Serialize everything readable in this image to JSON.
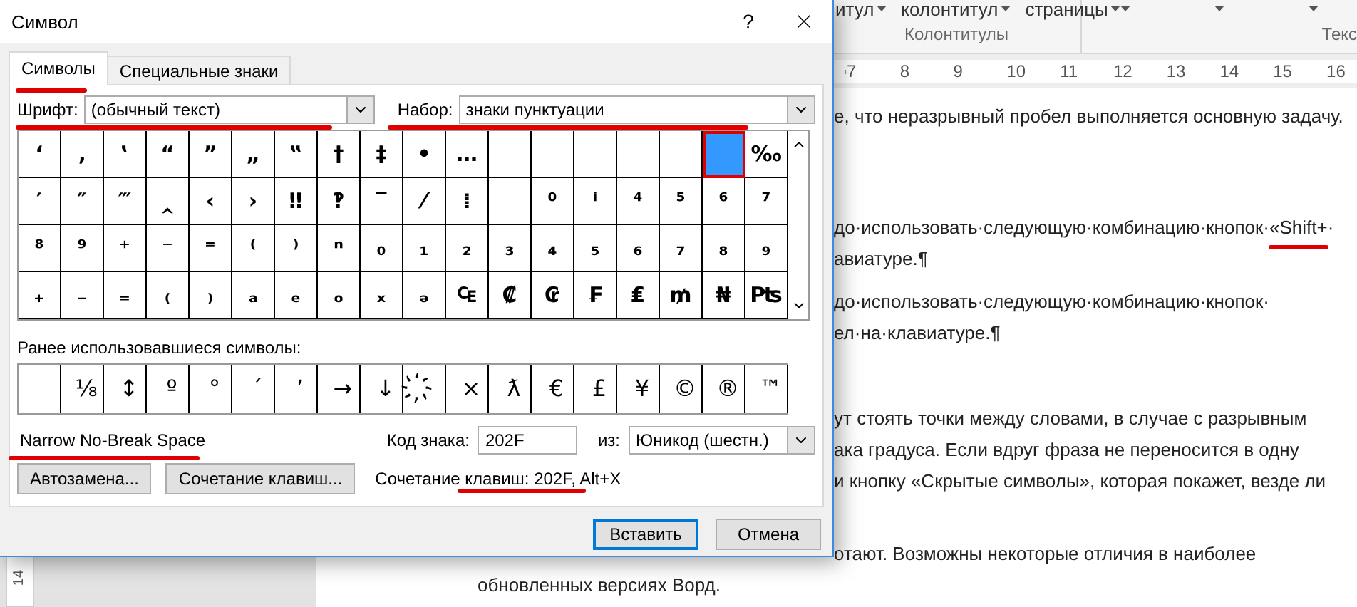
{
  "ribbon": {
    "groups": [
      {
        "label": "Колонтитулы",
        "buttons": [
          {
            "kind": "labeled",
            "label": "итул"
          },
          {
            "kind": "labeled",
            "label": "колонтитул"
          },
          {
            "kind": "labeled",
            "label": "страницы"
          }
        ]
      },
      {
        "label": "Текс",
        "buttons": [
          {
            "kind": "caret"
          },
          {
            "kind": "caret"
          },
          {
            "kind": "caret"
          }
        ]
      }
    ]
  },
  "ruler": {
    "numbers": [
      "7",
      "8",
      "9",
      "10",
      "11",
      "12",
      "13",
      "14",
      "15",
      "16"
    ]
  },
  "vertical_ruler": {
    "labels": [
      "14"
    ]
  },
  "document": {
    "paragraphs": [
      {
        "lines": [
          {
            "kind": "clipped",
            "text": "е, что неразрывный пробел выполняется основную задачу."
          }
        ]
      },
      {
        "lines": [
          {
            "kind": "clipped",
            "text": "до·использовать·следующую·комбинацию·кнопок·«Shift+·"
          },
          {
            "kind": "clipped",
            "text": "авиатуре.¶"
          }
        ]
      },
      {
        "lines": [
          {
            "kind": "clipped",
            "text": "до·использовать·следующую·комбинацию·кнопок·"
          },
          {
            "kind": "clipped",
            "text": "ел·на·клавиатуре.¶"
          }
        ]
      },
      {
        "lines": [
          {
            "kind": "clipped",
            "text": "ут стоять точки между словами, в случае с разрывным"
          },
          {
            "kind": "clipped",
            "text": "ака градуса. Если вдруг фраза не переносится в одну"
          },
          {
            "kind": "clipped",
            "text": "и кнопку «Скрытые символы», которая покажет, везде ли"
          }
        ]
      },
      {
        "lines": [
          {
            "kind": "clipped",
            "text": "отают. Возможны некоторые отличия в наиболее"
          },
          {
            "kind": "full",
            "text": "обновленных версиях Ворд."
          }
        ]
      }
    ]
  },
  "dialog": {
    "title": "Символ",
    "help": "?",
    "tabs": [
      {
        "label": "Символы",
        "selected": true
      },
      {
        "label": "Специальные знаки",
        "selected": false
      }
    ],
    "font": {
      "label": "Шрифт:",
      "value": "(обычный текст)"
    },
    "subset": {
      "label": "Набор:",
      "value": "знаки пунктуации"
    },
    "grid": {
      "rows": [
        {
          "cells": [
            {
              "kind": "glyph",
              "char": "‘",
              "selected": false
            },
            {
              "kind": "glyph",
              "char": "‚",
              "selected": false
            },
            {
              "kind": "glyph",
              "char": "‛",
              "selected": false
            },
            {
              "kind": "glyph",
              "char": "“",
              "selected": false
            },
            {
              "kind": "glyph",
              "char": "”",
              "selected": false
            },
            {
              "kind": "glyph",
              "char": "„",
              "selected": false
            },
            {
              "kind": "glyph",
              "char": "‟",
              "selected": false
            },
            {
              "kind": "glyph",
              "char": "†",
              "selected": false
            },
            {
              "kind": "glyph",
              "char": "‡",
              "selected": false
            },
            {
              "kind": "glyph",
              "char": "•",
              "selected": false
            },
            {
              "kind": "glyph",
              "char": "…",
              "selected": false
            },
            {
              "kind": "blank",
              "selected": false
            },
            {
              "kind": "blank",
              "selected": false
            },
            {
              "kind": "blank",
              "selected": false
            },
            {
              "kind": "blank",
              "selected": false
            },
            {
              "kind": "blank",
              "selected": false
            },
            {
              "kind": "blank",
              "selected": true
            },
            {
              "kind": "glyph",
              "char": "‰",
              "selected": false
            }
          ]
        },
        {
          "cells": [
            {
              "kind": "glyph",
              "char": "′",
              "selected": false
            },
            {
              "kind": "glyph",
              "char": "″",
              "selected": false
            },
            {
              "kind": "glyph",
              "char": "‴",
              "selected": false
            },
            {
              "kind": "glyph",
              "char": "‸",
              "selected": false
            },
            {
              "kind": "glyph",
              "char": "‹",
              "selected": false
            },
            {
              "kind": "glyph",
              "char": "›",
              "selected": false
            },
            {
              "kind": "glyph",
              "char": "‼",
              "selected": false
            },
            {
              "kind": "glyph",
              "char": "‽",
              "selected": false
            },
            {
              "kind": "glyph",
              "char": "‾",
              "selected": false
            },
            {
              "kind": "glyph",
              "char": "⁄",
              "selected": false
            },
            {
              "kind": "glyph",
              "char": "⁞",
              "selected": false
            },
            {
              "kind": "blank",
              "selected": false
            },
            {
              "kind": "glyph",
              "char": "⁰",
              "selected": false
            },
            {
              "kind": "glyph",
              "char": "ⁱ",
              "selected": false
            },
            {
              "kind": "glyph",
              "char": "⁴",
              "selected": false
            },
            {
              "kind": "glyph",
              "char": "⁵",
              "selected": false
            },
            {
              "kind": "glyph",
              "char": "⁶",
              "selected": false
            },
            {
              "kind": "glyph",
              "char": "⁷",
              "selected": false
            }
          ]
        },
        {
          "cells": [
            {
              "kind": "glyph",
              "char": "⁸",
              "selected": false
            },
            {
              "kind": "glyph",
              "char": "⁹",
              "selected": false
            },
            {
              "kind": "glyph",
              "char": "⁺",
              "selected": false
            },
            {
              "kind": "glyph",
              "char": "⁻",
              "selected": false
            },
            {
              "kind": "glyph",
              "char": "⁼",
              "selected": false
            },
            {
              "kind": "glyph",
              "char": "⁽",
              "selected": false
            },
            {
              "kind": "glyph",
              "char": "⁾",
              "selected": false
            },
            {
              "kind": "glyph",
              "char": "ⁿ",
              "selected": false
            },
            {
              "kind": "glyph",
              "char": "₀",
              "selected": false
            },
            {
              "kind": "glyph",
              "char": "₁",
              "selected": false
            },
            {
              "kind": "glyph",
              "char": "₂",
              "selected": false
            },
            {
              "kind": "glyph",
              "char": "₃",
              "selected": false
            },
            {
              "kind": "glyph",
              "char": "₄",
              "selected": false
            },
            {
              "kind": "glyph",
              "char": "₅",
              "selected": false
            },
            {
              "kind": "glyph",
              "char": "₆",
              "selected": false
            },
            {
              "kind": "glyph",
              "char": "₇",
              "selected": false
            },
            {
              "kind": "glyph",
              "char": "₈",
              "selected": false
            },
            {
              "kind": "glyph",
              "char": "₉",
              "selected": false
            }
          ]
        },
        {
          "cells": [
            {
              "kind": "glyph",
              "char": "₊",
              "selected": false
            },
            {
              "kind": "glyph",
              "char": "₋",
              "selected": false
            },
            {
              "kind": "glyph",
              "char": "₌",
              "selected": false
            },
            {
              "kind": "glyph",
              "char": "₍",
              "selected": false
            },
            {
              "kind": "glyph",
              "char": "₎",
              "selected": false
            },
            {
              "kind": "glyph",
              "char": "ₐ",
              "selected": false
            },
            {
              "kind": "glyph",
              "char": "ₑ",
              "selected": false
            },
            {
              "kind": "glyph",
              "char": "ₒ",
              "selected": false
            },
            {
              "kind": "glyph",
              "char": "ₓ",
              "selected": false
            },
            {
              "kind": "glyph",
              "char": "ₔ",
              "selected": false
            },
            {
              "kind": "glyph",
              "char": "₠",
              "selected": false
            },
            {
              "kind": "glyph",
              "char": "₡",
              "selected": false
            },
            {
              "kind": "glyph",
              "char": "₢",
              "selected": false
            },
            {
              "kind": "glyph",
              "char": "₣",
              "selected": false
            },
            {
              "kind": "glyph",
              "char": "₤",
              "selected": false
            },
            {
              "kind": "glyph",
              "char": "₥",
              "selected": false
            },
            {
              "kind": "glyph",
              "char": "₦",
              "selected": false
            },
            {
              "kind": "glyph",
              "char": "₧",
              "selected": false
            }
          ]
        }
      ]
    },
    "recent": {
      "label": "Ранее использовавшиеся символы:",
      "items": [
        {
          "kind": "blank"
        },
        {
          "kind": "glyph",
          "char": "⅛"
        },
        {
          "kind": "glyph",
          "char": "↕"
        },
        {
          "kind": "glyph",
          "char": "º"
        },
        {
          "kind": "glyph",
          "char": "°"
        },
        {
          "kind": "glyph",
          "char": "´"
        },
        {
          "kind": "glyph",
          "char": "’"
        },
        {
          "kind": "glyph",
          "char": "→"
        },
        {
          "kind": "glyph",
          "char": "↓"
        },
        {
          "kind": "glyph",
          "char": "҉"
        },
        {
          "kind": "glyph",
          "char": "×"
        },
        {
          "kind": "glyph",
          "char": "ƛ"
        },
        {
          "kind": "glyph",
          "char": "€"
        },
        {
          "kind": "glyph",
          "char": "£"
        },
        {
          "kind": "glyph",
          "char": "¥"
        },
        {
          "kind": "glyph",
          "char": "©"
        },
        {
          "kind": "glyph",
          "char": "®"
        },
        {
          "kind": "glyph",
          "char": "™"
        }
      ]
    },
    "symbol_name": "Narrow No-Break Space",
    "code": {
      "label": "Код знака:",
      "value": "202F"
    },
    "from": {
      "label": "из:",
      "value": "Юникод (шестн.)"
    },
    "buttons": [
      "Автозамена...",
      "Сочетание клавиш..."
    ],
    "shortcut": {
      "label": "Сочетание клавиш:",
      "value": "202F, Alt+X"
    },
    "footer": [
      {
        "label": "Вставить",
        "kind": "primary"
      },
      {
        "label": "Отмена",
        "kind": "normal"
      }
    ]
  }
}
